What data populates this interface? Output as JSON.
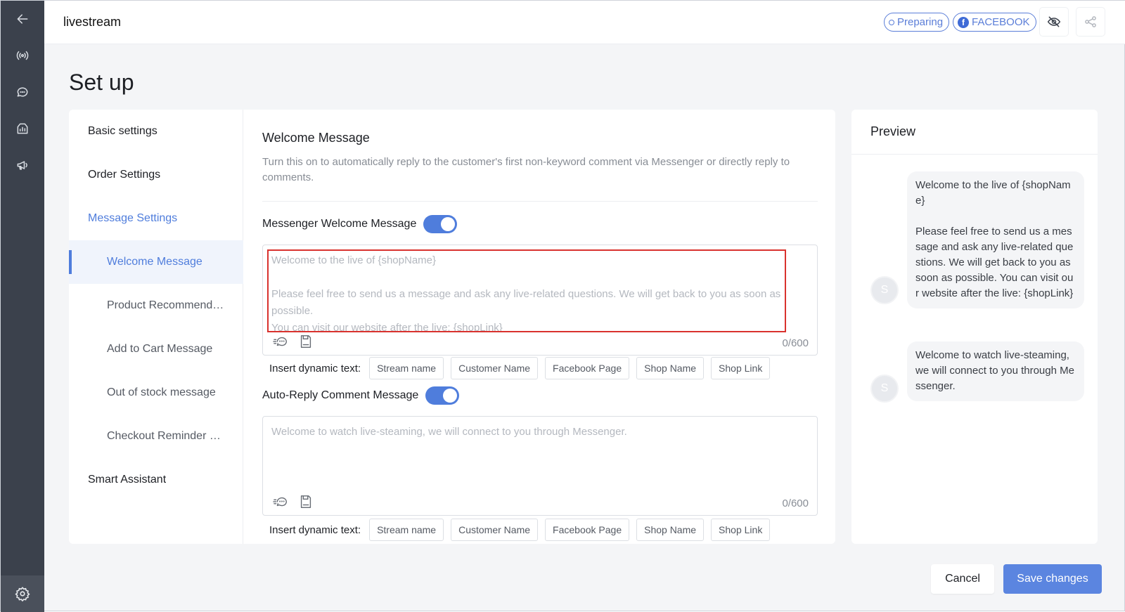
{
  "topbar": {
    "title": "livestream",
    "status_badge": "Preparing",
    "platform_badge": "FACEBOOK"
  },
  "rail": {
    "icons": [
      "back-arrow-icon",
      "broadcast-icon",
      "chat-icon",
      "analytics-icon",
      "megaphone-icon",
      "settings-gear-icon"
    ]
  },
  "page": {
    "title": "Set up"
  },
  "nav": {
    "basic": "Basic settings",
    "order": "Order Settings",
    "message": "Message Settings",
    "welcome": "Welcome Message",
    "product": "Product Recommend…",
    "cart": "Add to Cart Message",
    "stock": "Out of stock message",
    "checkout": "Checkout Reminder …",
    "assistant": "Smart Assistant"
  },
  "section": {
    "title": "Welcome Message",
    "description": "Turn this on to automatically reply to the customer's first non-keyword comment via Messenger or directly reply to comments."
  },
  "messenger": {
    "label": "Messenger Welcome Message",
    "enabled": true,
    "placeholder": "Welcome to the live of {shopName}\n\nPlease feel free to send us a message and ask any live-related questions. We will get back to you as soon as possible.\nYou can visit our website after the live: {shopLink}",
    "counter": "0/600"
  },
  "comment": {
    "label": "Auto-Reply Comment Message",
    "enabled": true,
    "placeholder": "Welcome to watch live-steaming, we will connect to you through Messenger.",
    "counter": "0/600"
  },
  "dynamic": {
    "label": "Insert dynamic text:",
    "chips": [
      "Stream name",
      "Customer Name",
      "Facebook Page",
      "Shop Name",
      "Shop Link"
    ]
  },
  "preview": {
    "title": "Preview",
    "avatar": "S",
    "bubble1": "Welcome to the live of {shopName}\n\nPlease feel free to send us a message and ask any live-related questions. We will get back to you as soon as possible. You can visit our website after the live: {shopLink}",
    "bubble2": "Welcome to watch live-steaming, we will connect to you through Messenger."
  },
  "footer": {
    "cancel": "Cancel",
    "save": "Save changes"
  },
  "colors": {
    "accent": "#4f7ddc",
    "rail": "#3b414c",
    "highlight": "#d9322e"
  }
}
